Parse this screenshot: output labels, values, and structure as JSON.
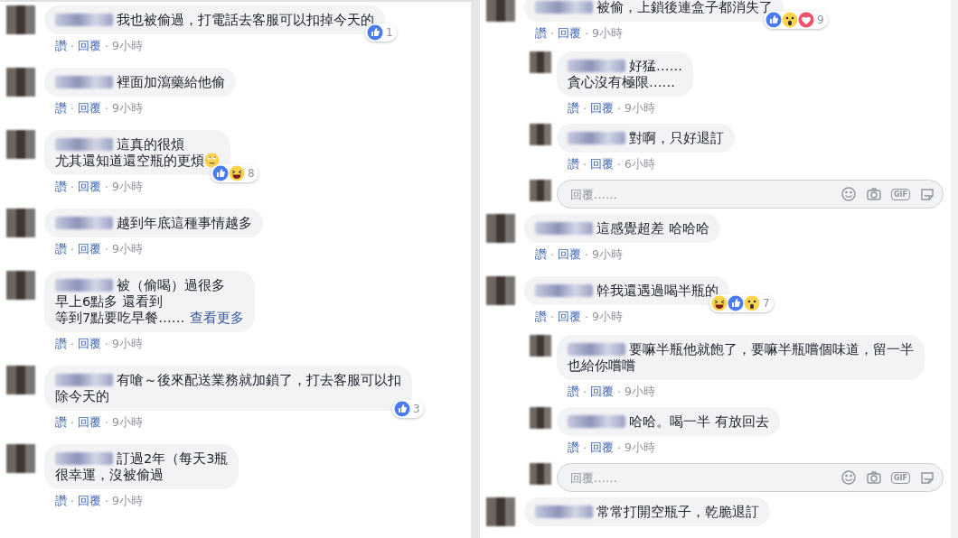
{
  "separator": "·",
  "columns": [
    {
      "comments": [
        {
          "lines": [
            "我也被偷過，打電話去客服可以扣掉今天的"
          ],
          "reactions": {
            "icons": [
              {
                "kind": "like"
              }
            ],
            "count": "1"
          },
          "like_label": "讚",
          "reply_label": "回覆",
          "time": "9小時"
        },
        {
          "lines": [
            "裡面加瀉藥給他偷"
          ],
          "like_label": "讚",
          "reply_label": "回覆",
          "time": "9小時"
        },
        {
          "lines": [
            "這真的很煩",
            "尤其還知道還空瓶的更煩"
          ],
          "emoji": {
            "kind": "eye-roll"
          },
          "reactions": {
            "icons": [
              {
                "kind": "like"
              },
              {
                "kind": "haha"
              }
            ],
            "count": "8"
          },
          "like_label": "讚",
          "reply_label": "回覆",
          "time": "9小時"
        },
        {
          "lines": [
            "越到年底這種事情越多"
          ],
          "like_label": "讚",
          "reply_label": "回覆",
          "time": "9小時"
        },
        {
          "lines": [
            "被（偷喝）過很多",
            "早上6點多 還看到",
            "等到7點要吃早餐……"
          ],
          "more_link": "查看更多",
          "like_label": "讚",
          "reply_label": "回覆",
          "time": "9小時"
        },
        {
          "lines": [
            "有嗆～後來配送業務就加鎖了，打去客服可以扣",
            "除今天的"
          ],
          "reactions": {
            "icons": [
              {
                "kind": "like"
              }
            ],
            "count": "3"
          },
          "like_label": "讚",
          "reply_label": "回覆",
          "time": "9小時"
        },
        {
          "lines": [
            "訂過2年（每天3瓶",
            "很幸運，沒被偷過"
          ],
          "like_label": "讚",
          "reply_label": "回覆",
          "time": "9小時"
        }
      ]
    },
    {
      "comments": [
        {
          "lines": [
            "被偷，上鎖後連盒子都消失了"
          ],
          "reactions": {
            "icons": [
              {
                "kind": "like"
              },
              {
                "kind": "wow"
              },
              {
                "kind": "love"
              }
            ],
            "count": "9"
          },
          "like_label": "讚",
          "reply_label": "回覆",
          "time": "9小時",
          "replies": [
            {
              "lines": [
                "好猛……",
                "貪心沒有極限……"
              ],
              "like_label": "讚",
              "reply_label": "回覆",
              "time": "9小時"
            },
            {
              "lines": [
                "對啊，只好退訂"
              ],
              "like_label": "讚",
              "reply_label": "回覆",
              "time": "6小時"
            }
          ],
          "reply_box": {
            "placeholder": "回覆……",
            "gif_label": "GIF"
          }
        },
        {
          "lines": [
            "這感覺超差 哈哈哈"
          ],
          "like_label": "讚",
          "reply_label": "回覆",
          "time": "9小時"
        },
        {
          "lines": [
            "幹我還遇過喝半瓶的"
          ],
          "reactions": {
            "icons": [
              {
                "kind": "haha"
              },
              {
                "kind": "like"
              },
              {
                "kind": "wow"
              }
            ],
            "count": "7"
          },
          "like_label": "讚",
          "reply_label": "回覆",
          "time": "9小時",
          "replies": [
            {
              "lines": [
                "要嘛半瓶他就飽了，要嘛半瓶嚐個味道，留一半",
                "也給你嚐嚐"
              ],
              "like_label": "讚",
              "reply_label": "回覆",
              "time": "9小時"
            },
            {
              "lines": [
                "哈哈。喝一半 有放回去"
              ],
              "like_label": "讚",
              "reply_label": "回覆",
              "time": "9小時"
            }
          ],
          "reply_box": {
            "placeholder": "回覆……",
            "gif_label": "GIF"
          }
        },
        {
          "lines": [
            "常常打開空瓶子，乾脆退訂"
          ]
        }
      ]
    }
  ]
}
